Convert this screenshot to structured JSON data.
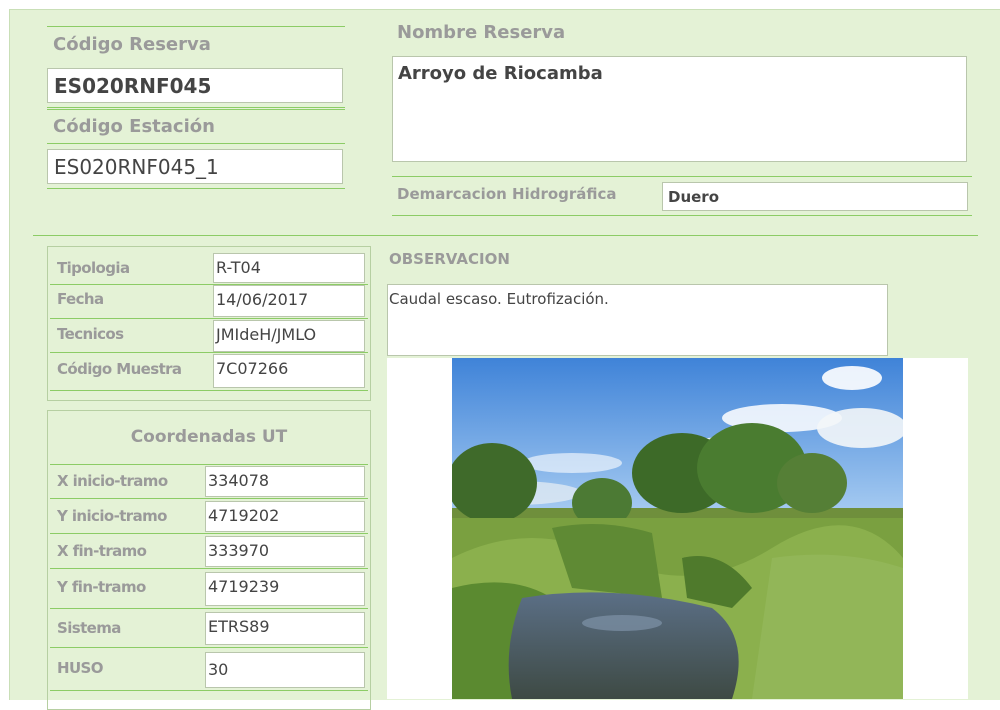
{
  "header": {
    "codigo_reserva_label": "Código Reserva",
    "codigo_reserva_value": "ES020RNF045",
    "codigo_estacion_label": "Código Estación",
    "codigo_estacion_value": "ES020RNF045_1",
    "nombre_reserva_label": "Nombre Reserva",
    "nombre_reserva_value": "Arroyo de Riocamba",
    "demarcacion_label": "Demarcacion Hidrográfica",
    "demarcacion_value": "Duero"
  },
  "info": {
    "rows": [
      {
        "label": "Tipologia",
        "value": "R-T04"
      },
      {
        "label": "Fecha",
        "value": "14/06/2017"
      },
      {
        "label": "Tecnicos",
        "value": "JMIdeH/JMLO"
      },
      {
        "label": "Código Muestra",
        "value": "7C07266"
      }
    ]
  },
  "coords": {
    "title": "Coordenadas UT",
    "rows": [
      {
        "label": "X inicio-tramo",
        "value": "334078"
      },
      {
        "label": "Y inicio-tramo",
        "value": "4719202"
      },
      {
        "label": "X fin-tramo",
        "value": "333970"
      },
      {
        "label": "Y fin-tramo",
        "value": "4719239"
      },
      {
        "label": "Sistema",
        "value": "ETRS89"
      },
      {
        "label": "HUSO",
        "value": "30"
      }
    ]
  },
  "observacion": {
    "label": "OBSERVACION",
    "text": "Caudal escaso. Eutrofización."
  },
  "colors": {
    "panel_bg": "#e4f2d6",
    "line": "#8ccc66",
    "label": "#9a9a9a"
  }
}
